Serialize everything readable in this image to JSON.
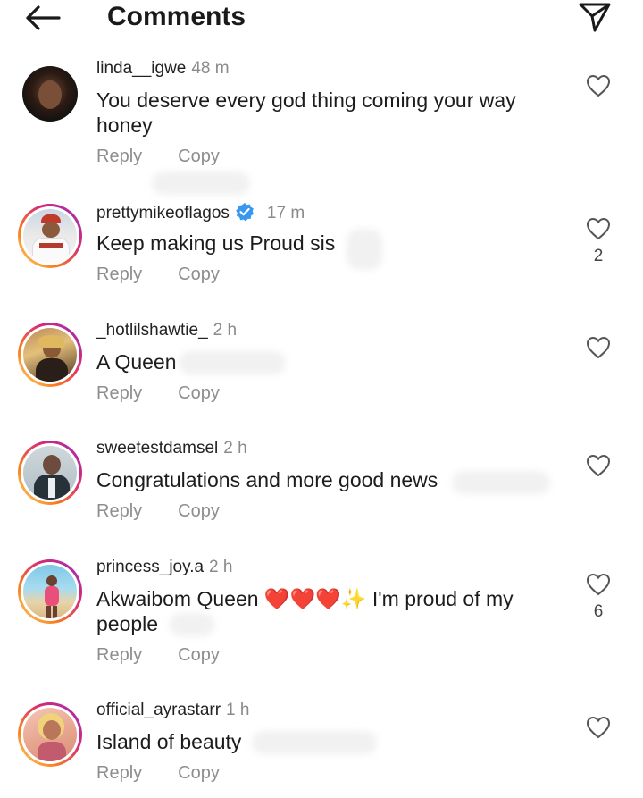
{
  "header": {
    "title": "Comments"
  },
  "comments": [
    {
      "username": "linda__igwe",
      "time": "48 m",
      "text": "You deserve every god thing coming your way honey",
      "likes": "",
      "reply": "Reply",
      "copy": "Copy",
      "verified": false
    },
    {
      "username": "prettymikeoflagos",
      "time": "17 m",
      "text": "Keep making us Proud sis",
      "likes": "2",
      "reply": "Reply",
      "copy": "Copy",
      "verified": true
    },
    {
      "username": "_hotlilshawtie_",
      "time": "2 h",
      "text": "A Queen",
      "likes": "",
      "reply": "Reply",
      "copy": "Copy",
      "verified": false
    },
    {
      "username": "sweetestdamsel",
      "time": "2 h",
      "text": "Congratulations and more good news",
      "likes": "",
      "reply": "Reply",
      "copy": "Copy",
      "verified": false
    },
    {
      "username": "princess_joy.a",
      "time": "2 h",
      "text": "Akwaibom Queen ❤️❤️❤️✨ I'm proud of my people",
      "likes": "6",
      "reply": "Reply",
      "copy": "Copy",
      "verified": false
    },
    {
      "username": "official_ayrastarr",
      "time": "1 h",
      "text": "Island of beauty",
      "likes": "",
      "reply": "Reply",
      "copy": "Copy",
      "verified": false
    }
  ],
  "icons": {
    "back": "arrow-left-icon",
    "send": "paper-plane-icon",
    "like": "heart-outline-icon",
    "verified": "verified-badge-icon"
  },
  "colors": {
    "ring_start": "#feda75",
    "ring_mid": "#d62976",
    "ring_end": "#962fbf",
    "verified": "#3897f0",
    "muted": "#8e8e8e"
  }
}
